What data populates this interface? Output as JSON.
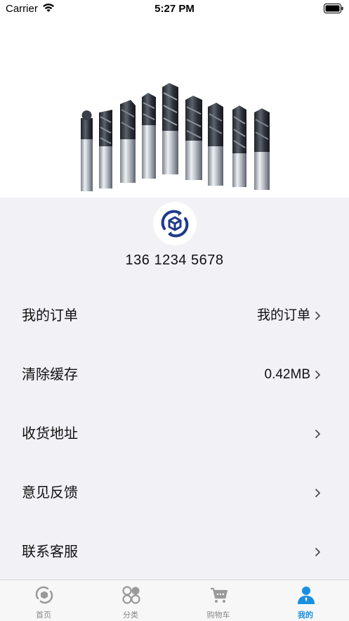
{
  "status_bar": {
    "carrier": "Carrier",
    "time": "5:27 PM"
  },
  "profile": {
    "phone": "136 1234 5678"
  },
  "menu": [
    {
      "label": "我的订单",
      "value": "我的订单"
    },
    {
      "label": "清除缓存",
      "value": "0.42MB"
    },
    {
      "label": "收货地址",
      "value": ""
    },
    {
      "label": "意见反馈",
      "value": ""
    },
    {
      "label": "联系客服",
      "value": ""
    }
  ],
  "tabs": [
    {
      "label": "首页",
      "icon": "home-icon"
    },
    {
      "label": "分类",
      "icon": "category-icon"
    },
    {
      "label": "购物车",
      "icon": "cart-icon"
    },
    {
      "label": "我的",
      "icon": "profile-icon",
      "active": true
    }
  ],
  "colors": {
    "accent": "#1a8fe0",
    "brand_navy": "#1f3a8a",
    "background": "#f2f1f6"
  }
}
